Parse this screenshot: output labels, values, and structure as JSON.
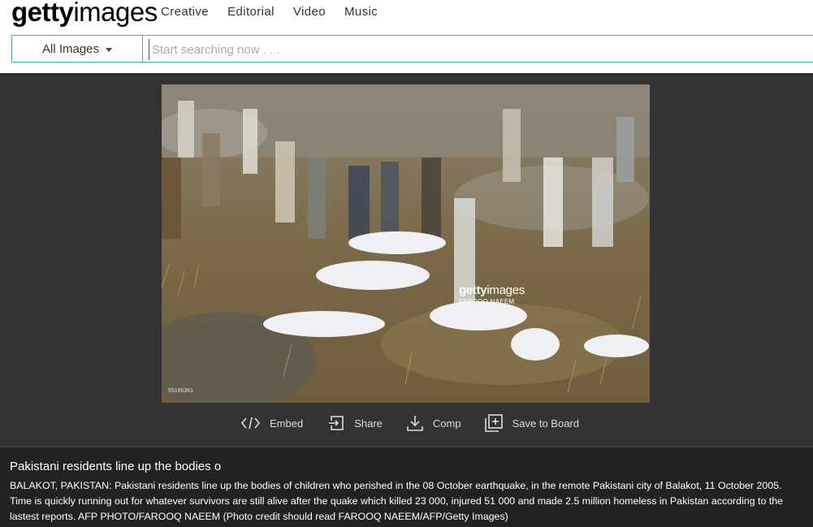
{
  "header": {
    "logo": {
      "bold": "getty",
      "light": "images"
    },
    "nav": [
      "Creative",
      "Editorial",
      "Video",
      "Music"
    ]
  },
  "search": {
    "filter_label": "All Images",
    "placeholder": "Start searching now . . ."
  },
  "photo": {
    "watermark_brand_bold": "getty",
    "watermark_brand_light": "images",
    "watermark_credit": "FAROOQ NAEEM",
    "photo_id": "55186361"
  },
  "actions": [
    {
      "label": "Embed",
      "icon": "embed-icon"
    },
    {
      "label": "Share",
      "icon": "share-icon"
    },
    {
      "label": "Comp",
      "icon": "download-icon"
    },
    {
      "label": "Save to Board",
      "icon": "add-board-icon"
    }
  ],
  "caption": {
    "title": "Pakistani residents line up the bodies o",
    "body": "BALAKOT, PAKISTAN: Pakistani residents line up the bodies of children who perished in the 08 October earthquake, in the remote Pakistani city of Balakot, 11 October 2005. Time is quickly running out for whatever survivors are still alive after the quake which killed 23 000, injured 51 000 and made 2.5 million homeless in Pakistan according to the lastest reports. AFP PHOTO/FAROOQ NAEEM (Photo credit should read FAROOQ NAEEM/AFP/Getty Images)"
  },
  "colors": {
    "background": "#333333",
    "accent_border": "#4ea3b5",
    "caption_bg": "#222222"
  }
}
